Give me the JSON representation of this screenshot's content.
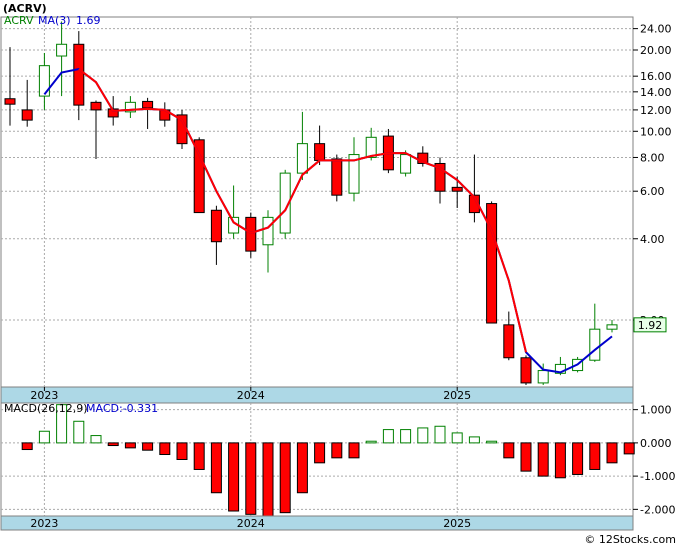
{
  "header": {
    "ticker": "(ACRV)",
    "symbol_label": "ACRV",
    "ma_label": "MA(3)",
    "ma_value": "1.69",
    "price_tag": "1.92"
  },
  "macd_header": {
    "label": "MACD(26,12,9)",
    "value_label": "MACD:-0.331"
  },
  "watermark": "© 12Stocks.com",
  "colors": {
    "up_candle": "#008000",
    "down_candle": "#ff0000",
    "ma_line": "#0000cc",
    "ma_line_down": "#ff0000",
    "axis_band": "#add8e6",
    "price_tag_bg": "#e8ffe8",
    "macd_label": "#0000cc",
    "ticker_label": "#000000",
    "symbol_label": "#008000"
  },
  "chart_data": [
    {
      "type": "candlestick",
      "title": "(ACRV)",
      "y_scale": "log",
      "y_ticks": [
        "24.00",
        "20.00",
        "16.00",
        "14.00",
        "12.00",
        "10.00",
        "8.00",
        "6.00",
        "4.00",
        "2.00"
      ],
      "year_labels": [
        {
          "label": "2023",
          "index": 2
        },
        {
          "label": "2024",
          "index": 14
        },
        {
          "label": "2025",
          "index": 26
        }
      ],
      "candles": [
        {
          "o": 13.2,
          "h": 20.5,
          "l": 10.5,
          "c": 12.6
        },
        {
          "o": 12.0,
          "h": 15.5,
          "l": 10.4,
          "c": 11.0
        },
        {
          "o": 13.5,
          "h": 19.5,
          "l": 12.0,
          "c": 17.5
        },
        {
          "o": 19.0,
          "h": 25.5,
          "l": 13.5,
          "c": 21.0
        },
        {
          "o": 21.0,
          "h": 23.5,
          "l": 11.0,
          "c": 12.5
        },
        {
          "o": 12.8,
          "h": 13.0,
          "l": 7.9,
          "c": 12.0
        },
        {
          "o": 12.1,
          "h": 13.5,
          "l": 10.5,
          "c": 11.3
        },
        {
          "o": 11.8,
          "h": 13.5,
          "l": 11.2,
          "c": 12.8
        },
        {
          "o": 12.9,
          "h": 13.3,
          "l": 10.2,
          "c": 12.2
        },
        {
          "o": 12.0,
          "h": 12.8,
          "l": 10.4,
          "c": 11.0
        },
        {
          "o": 11.5,
          "h": 12.0,
          "l": 8.6,
          "c": 9.0
        },
        {
          "o": 9.3,
          "h": 9.5,
          "l": 5.0,
          "c": 5.0
        },
        {
          "o": 5.1,
          "h": 5.3,
          "l": 3.2,
          "c": 3.9
        },
        {
          "o": 4.2,
          "h": 6.3,
          "l": 4.0,
          "c": 4.8
        },
        {
          "o": 4.8,
          "h": 5.0,
          "l": 3.4,
          "c": 3.6
        },
        {
          "o": 3.8,
          "h": 5.1,
          "l": 3.0,
          "c": 4.8
        },
        {
          "o": 4.2,
          "h": 7.2,
          "l": 4.0,
          "c": 7.0
        },
        {
          "o": 7.0,
          "h": 11.8,
          "l": 6.6,
          "c": 9.0
        },
        {
          "o": 9.0,
          "h": 10.5,
          "l": 7.5,
          "c": 7.8
        },
        {
          "o": 7.9,
          "h": 8.2,
          "l": 5.5,
          "c": 5.8
        },
        {
          "o": 5.9,
          "h": 9.5,
          "l": 5.5,
          "c": 8.2
        },
        {
          "o": 8.0,
          "h": 10.3,
          "l": 7.8,
          "c": 9.5
        },
        {
          "o": 9.6,
          "h": 10.2,
          "l": 7.0,
          "c": 7.2
        },
        {
          "o": 7.0,
          "h": 8.5,
          "l": 6.8,
          "c": 8.2
        },
        {
          "o": 8.3,
          "h": 8.8,
          "l": 7.4,
          "c": 7.6
        },
        {
          "o": 7.6,
          "h": 8.0,
          "l": 5.4,
          "c": 6.0
        },
        {
          "o": 6.2,
          "h": 6.8,
          "l": 5.2,
          "c": 6.0
        },
        {
          "o": 5.8,
          "h": 8.2,
          "l": 4.6,
          "c": 5.0
        },
        {
          "o": 5.4,
          "h": 5.5,
          "l": 1.95,
          "c": 1.95
        },
        {
          "o": 1.92,
          "h": 2.15,
          "l": 1.42,
          "c": 1.45
        },
        {
          "o": 1.45,
          "h": 1.48,
          "l": 1.15,
          "c": 1.17
        },
        {
          "o": 1.17,
          "h": 1.38,
          "l": 1.15,
          "c": 1.3
        },
        {
          "o": 1.27,
          "h": 1.46,
          "l": 1.25,
          "c": 1.37
        },
        {
          "o": 1.3,
          "h": 1.46,
          "l": 1.28,
          "c": 1.43
        },
        {
          "o": 1.42,
          "h": 2.3,
          "l": 1.4,
          "c": 1.85
        },
        {
          "o": 1.85,
          "h": 2.0,
          "l": 1.8,
          "c": 1.92
        }
      ],
      "ma_series": {
        "name": "MA(3)",
        "values": [
          null,
          null,
          13.7,
          16.5,
          17.0,
          15.2,
          11.9,
          12.0,
          12.1,
          12.0,
          11.0,
          8.2,
          6.0,
          4.6,
          4.2,
          4.4,
          5.1,
          6.9,
          7.8,
          7.8,
          7.8,
          8.1,
          8.3,
          8.3,
          7.7,
          7.3,
          6.6,
          5.7,
          4.3,
          2.8,
          1.52,
          1.31,
          1.28,
          1.37,
          1.55,
          1.74
        ]
      },
      "ma_down_from_index": 4,
      "ma_down_until_index": 30
    },
    {
      "type": "bar",
      "title": "MACD(26,12,9)",
      "y_ticks": [
        "1.000",
        "0.000",
        "-1.000",
        "-2.000"
      ],
      "ylim": [
        -2.2,
        1.2
      ],
      "year_labels": [
        {
          "label": "2023",
          "index": 2
        },
        {
          "label": "2024",
          "index": 14
        },
        {
          "label": "2025",
          "index": 26
        }
      ],
      "values": [
        0,
        -0.2,
        0.35,
        1.15,
        0.65,
        0.22,
        -0.08,
        -0.15,
        -0.22,
        -0.35,
        -0.5,
        -0.8,
        -1.5,
        -2.05,
        -2.15,
        -2.2,
        -2.1,
        -1.5,
        -0.6,
        -0.45,
        -0.45,
        0.05,
        0.4,
        0.4,
        0.45,
        0.5,
        0.3,
        0.18,
        0.05,
        -0.45,
        -0.85,
        -1.0,
        -1.05,
        -0.95,
        -0.8,
        -0.6,
        -0.331
      ]
    }
  ]
}
